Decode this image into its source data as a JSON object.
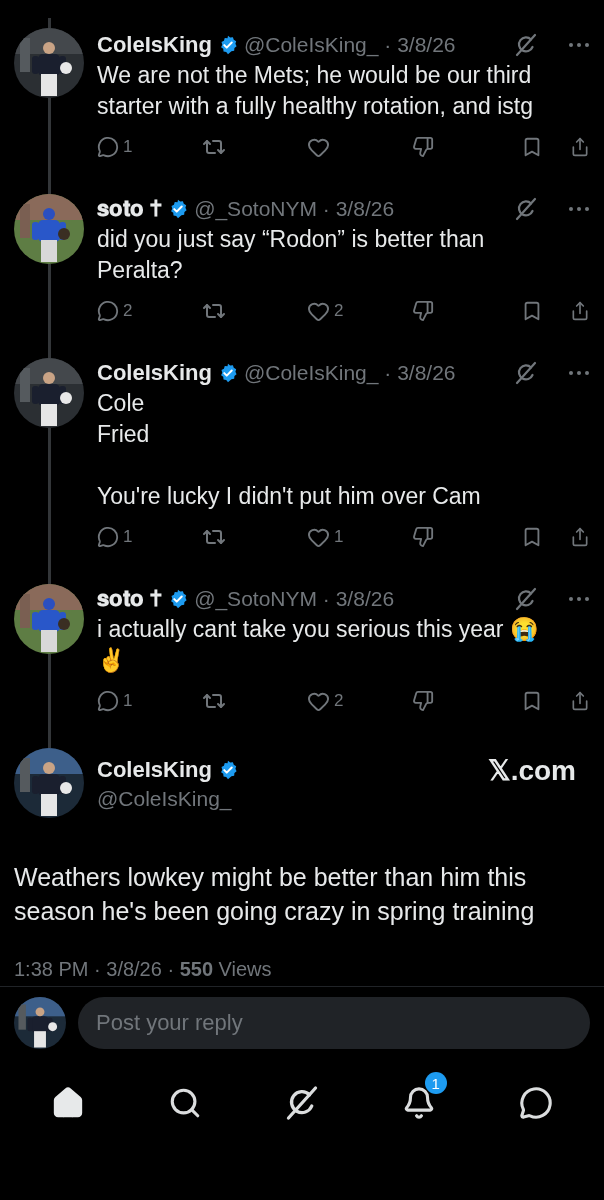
{
  "thread": [
    {
      "author": {
        "name": "ColeIsKing",
        "handle": "@ColeIsKing_",
        "separator": "·",
        "date": "3/8/26"
      },
      "text": "We are not the Mets; he would be our third starter with a fully healthy rotation, and istg",
      "reply_count": "1"
    },
    {
      "author": {
        "name": "𝐬𝐨𝐭𝐨 ✝",
        "handle": "@_SotoNYM",
        "separator": "·",
        "date": "3/8/26"
      },
      "text": "did you just say “Rodon” is better than Peralta?",
      "reply_count": "2",
      "like_count": "2"
    },
    {
      "author": {
        "name": "ColeIsKing",
        "handle": "@ColeIsKing_",
        "separator": "·",
        "date": "3/8/26"
      },
      "text": "Cole\nFried\n\nYou're lucky I didn't put him over Cam",
      "reply_count": "1",
      "like_count": "1"
    },
    {
      "author": {
        "name": "𝐬𝐨𝐭𝐨 ✝",
        "handle": "@_SotoNYM",
        "separator": "·",
        "date": "3/8/26"
      },
      "text": "i actually cant take you serious this year 😭 ✌️",
      "reply_count": "1",
      "like_count": "2"
    }
  ],
  "main_post": {
    "name": "ColeIsKing",
    "handle": "@ColeIsKing_",
    "source": "𝕏.com",
    "text": "Weathers lowkey might be better than him this season he's been going crazy in spring training",
    "meta": "1:38 PM · 3/8/26 · **550** Views"
  },
  "reply_box": {
    "placeholder": "Post your reply"
  },
  "nav": [
    {
      "kind": "home",
      "selected": true
    },
    {
      "kind": "search",
      "selected": false
    },
    {
      "kind": "grok",
      "selected": false
    },
    {
      "kind": "notifications",
      "selected": false,
      "badge": "1"
    },
    {
      "kind": "messages",
      "selected": false
    }
  ]
}
